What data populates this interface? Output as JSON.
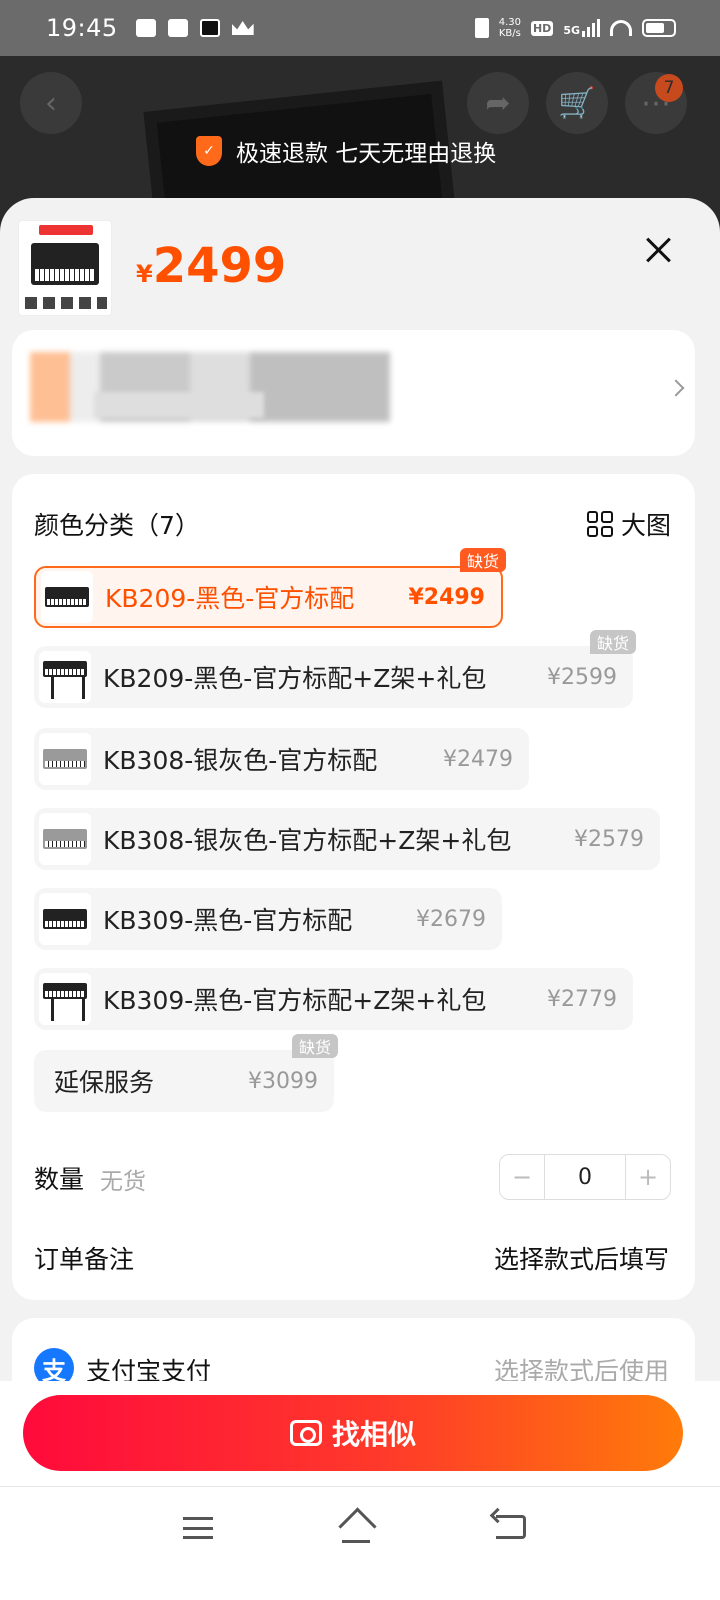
{
  "status_bar": {
    "time": "19:45",
    "net_speed": "4.30",
    "net_unit": "KB/s",
    "hd": "HD",
    "network": "5G"
  },
  "background": {
    "guarantee_text": "极速退款 七天无理由退换",
    "badge_count": "7"
  },
  "header": {
    "currency": "¥",
    "price": "2499"
  },
  "sku": {
    "title": "颜色分类（7）",
    "big_view_label": "大图",
    "options": [
      {
        "label": "KB209-黑色-官方标配",
        "price": "¥2499",
        "selected": true,
        "tag": "缺货"
      },
      {
        "label": "KB209-黑色-官方标配+Z架+礼包",
        "price": "¥2599",
        "selected": false,
        "tag": "缺货"
      },
      {
        "label": "KB308-银灰色-官方标配",
        "price": "¥2479",
        "selected": false,
        "tag": ""
      },
      {
        "label": "KB308-银灰色-官方标配+Z架+礼包",
        "price": "¥2579",
        "selected": false,
        "tag": ""
      },
      {
        "label": "KB309-黑色-官方标配",
        "price": "¥2679",
        "selected": false,
        "tag": ""
      },
      {
        "label": "KB309-黑色-官方标配+Z架+礼包",
        "price": "¥2779",
        "selected": false,
        "tag": ""
      },
      {
        "label": "延保服务",
        "price": "¥3099",
        "selected": false,
        "tag": "缺货"
      }
    ]
  },
  "quantity": {
    "label": "数量",
    "stock_status": "无货",
    "value": "0",
    "minus": "−",
    "plus": "+"
  },
  "order_note": {
    "label": "订单备注",
    "value": "选择款式后填写"
  },
  "payment": {
    "icon_char": "支",
    "label": "支付宝支付",
    "hint": "选择款式后使用"
  },
  "action": {
    "label": "找相似"
  },
  "colors": {
    "accent": "#ff5000",
    "tag_orange": "#ff5a1f",
    "tag_grey": "#c6c6c6",
    "alipay_blue": "#1677ff"
  }
}
